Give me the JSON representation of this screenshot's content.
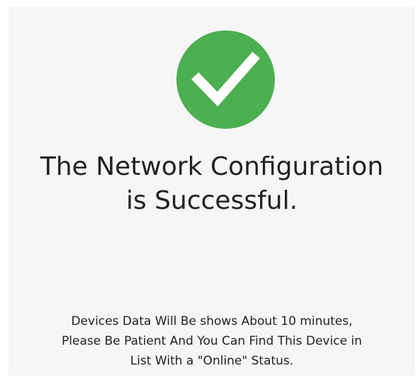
{
  "success": {
    "icon": "checkmark-icon",
    "color": "#4caf50"
  },
  "title": {
    "line1": "The Network Configuration",
    "line2": "is Successful."
  },
  "message": {
    "line1": "Devices Data Will Be shows About 10 minutes,",
    "line2": "Please Be Patient And You Can Find This Device in",
    "line3": "List With a \"Online\" Status."
  }
}
